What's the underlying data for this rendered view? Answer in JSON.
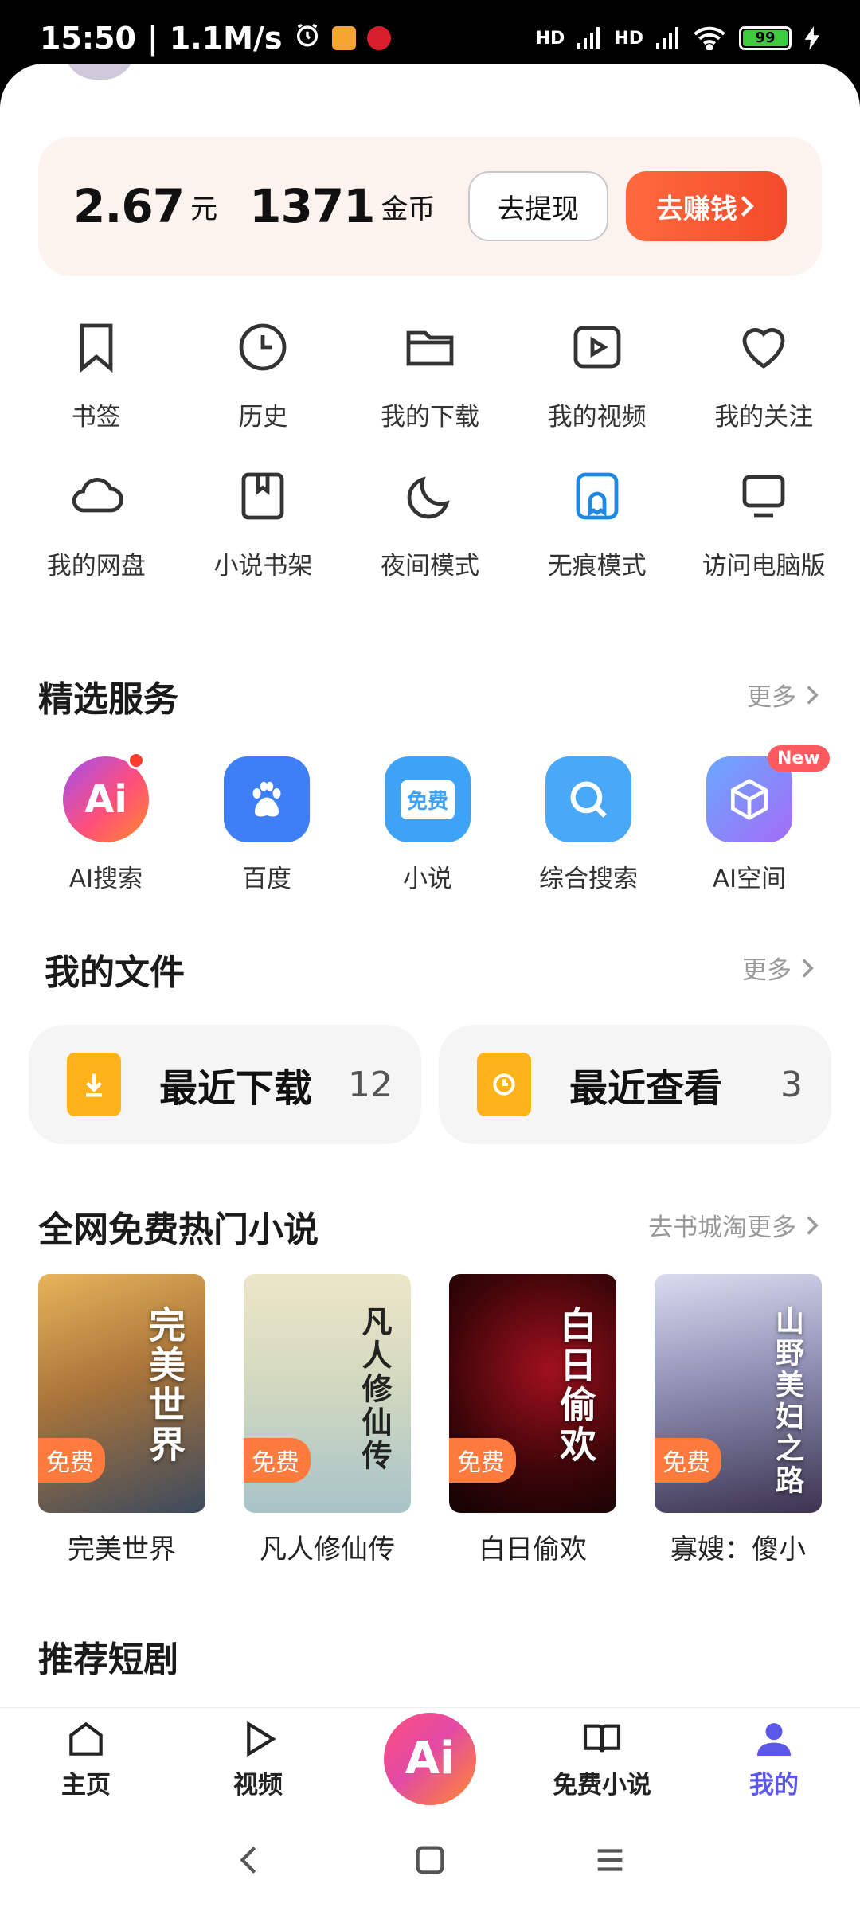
{
  "status_bar": {
    "time": "15:50",
    "speed": "1.1M/s",
    "net1": "HD",
    "net2": "HD",
    "battery": "99"
  },
  "wallet": {
    "balance": "2.67",
    "balance_unit": "元",
    "coins": "1371",
    "coins_unit": "金币",
    "withdraw_label": "去提现",
    "earn_label": "去赚钱"
  },
  "quick_items": [
    {
      "label": "书签",
      "icon": "bookmark-icon"
    },
    {
      "label": "历史",
      "icon": "clock-icon"
    },
    {
      "label": "我的下载",
      "icon": "folder-icon"
    },
    {
      "label": "我的视频",
      "icon": "video-icon"
    },
    {
      "label": "我的关注",
      "icon": "heart-icon"
    },
    {
      "label": "我的网盘",
      "icon": "cloud-icon"
    },
    {
      "label": "小说书架",
      "icon": "book-shelf-icon"
    },
    {
      "label": "夜间模式",
      "icon": "moon-icon"
    },
    {
      "label": "无痕模式",
      "icon": "ghost-icon"
    },
    {
      "label": "访问电脑版",
      "icon": "monitor-icon"
    }
  ],
  "services": {
    "title": "精选服务",
    "more": "更多",
    "items": [
      {
        "label": "AI搜索",
        "glyph": "Ai"
      },
      {
        "label": "百度",
        "glyph": ""
      },
      {
        "label": "小说",
        "glyph": "免费"
      },
      {
        "label": "综合搜索",
        "glyph": ""
      },
      {
        "label": "AI空间",
        "glyph": "",
        "badge": "New"
      }
    ]
  },
  "files": {
    "title": "我的文件",
    "more": "更多",
    "recent_download": {
      "label": "最近下载",
      "count": "12"
    },
    "recent_view": {
      "label": "最近查看",
      "count": "3"
    }
  },
  "novels": {
    "title": "全网免费热门小说",
    "more": "去书城淘更多",
    "free_tag": "免费",
    "books": [
      {
        "title": "完美世界",
        "cover_text": "完美世界"
      },
      {
        "title": "凡人修仙传",
        "cover_text": "凡人修仙传"
      },
      {
        "title": "白日偷欢",
        "cover_text": "白日偷欢"
      },
      {
        "title": "寡嫂：傻小",
        "cover_text": "山野美妇之路"
      }
    ]
  },
  "dramas": {
    "title": "推荐短剧"
  },
  "bottom_nav": {
    "home": "主页",
    "video": "视频",
    "ai": "Ai",
    "novel": "免费小说",
    "mine": "我的"
  },
  "colors": {
    "accent": "#5b57e8",
    "earn": "#f34a2b",
    "file_icon": "#ffb31a"
  }
}
